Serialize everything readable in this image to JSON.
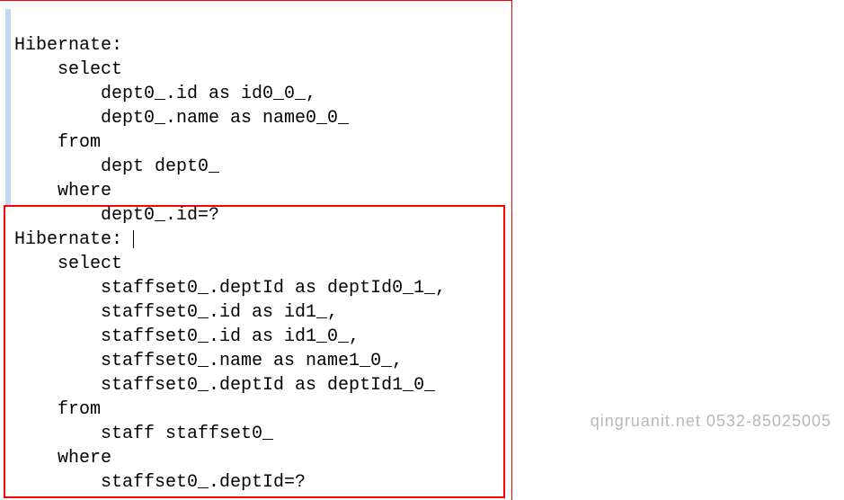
{
  "block1": {
    "label": "Hibernate:",
    "lines": [
      "    select",
      "        dept0_.id as id0_0_,",
      "        dept0_.name as name0_0_",
      "    from",
      "        dept dept0_",
      "    where",
      "        dept0_.id=?"
    ]
  },
  "block2": {
    "label": "Hibernate:",
    "lines": [
      "    select",
      "        staffset0_.deptId as deptId0_1_,",
      "        staffset0_.id as id1_,",
      "        staffset0_.id as id1_0_,",
      "        staffset0_.name as name1_0_,",
      "        staffset0_.deptId as deptId1_0_",
      "    from",
      "        staff staffset0_",
      "    where",
      "        staffset0_.deptId=?"
    ]
  },
  "watermark": "qingruanit.net 0532-85025005"
}
